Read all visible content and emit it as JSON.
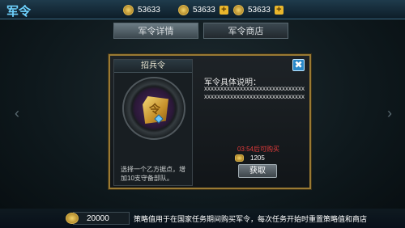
{
  "header": {
    "title": "军令",
    "resources": [
      {
        "icon": "gold-ingot-icon",
        "value": "53633",
        "has_plus": false
      },
      {
        "icon": "gold-coin-icon",
        "value": "53633",
        "has_plus": true
      },
      {
        "icon": "gold-token-icon",
        "value": "53633",
        "has_plus": true
      }
    ],
    "plus_label": "+"
  },
  "tabs": [
    {
      "label": "军令详情",
      "active": true
    },
    {
      "label": "军令商店",
      "active": false
    }
  ],
  "modal": {
    "header": "招兵令",
    "desc": "选择一个乙方据点，增加10支守备部队。",
    "detail_title": "军令具体说明：",
    "detail_body": "xxxxxxxxxxxxxxxxxxxxxxxxxxxxxxxxxxxxxxxxxxxxxxxxxxxxxxxxxxxxxx",
    "timer": "03:54后可购买",
    "cost": "1205",
    "buy_label": "获取",
    "close_label": "✖"
  },
  "background_cards": {
    "left_arrow": "‹",
    "right_arrow": "›",
    "price": "20000"
  },
  "footer": {
    "balance": "20000",
    "note": "策略值用于在国家任务期间购买军令，每次任务开始时重置策略值和商店"
  }
}
